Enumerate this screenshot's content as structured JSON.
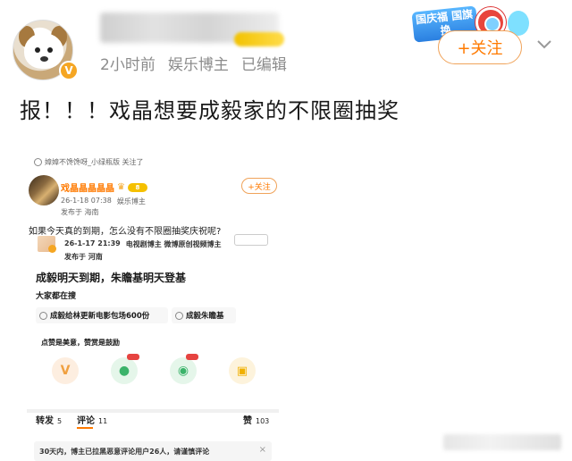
{
  "post": {
    "time": "2小时前",
    "category": "娱乐博主",
    "edited": "已编辑",
    "follow_label": "+关注",
    "text": "报！！！戏晶想要成毅家的不限圈抽奖",
    "festival_badge": "国庆福 国旗换"
  },
  "embedded": {
    "repost_line": "嫜嫜不馋馋呀_小绿瓶版 关注了",
    "name": "戏晶晶晶晶晶",
    "level": "8",
    "meta_time": "26-1-18 07:38",
    "meta_category": "娱乐博主",
    "location": "发布于 海南",
    "follow_label": "+关注",
    "text": "如果今天真的到期，怎么没有不限圈抽奖庆祝呢?",
    "quote": {
      "time": "26-1-17 21:39",
      "user_info": "电视剧博主 微博原创视频博主",
      "location": "发布于 河南",
      "title": "成毅明天到期，朱瞻基明天登基",
      "search_label": "大家都在搜",
      "tags": [
        "成毅给林更新电影包场600份",
        "成毅朱瞻基"
      ],
      "like_note": "点赞是美意，赞赏是鼓励"
    },
    "tabs": {
      "repost_label": "转发",
      "repost_count": "5",
      "comment_label": "评论",
      "comment_count": "11",
      "like_label": "赞",
      "like_count": "103"
    },
    "notice": "30天内，博主已拉黑恶意评论用户26人，请谨慎评论",
    "notice_close": "×"
  },
  "colors": {
    "accent": "#ff7a00",
    "verified": "#f5a623",
    "meta_gray": "#8c8c8c"
  }
}
